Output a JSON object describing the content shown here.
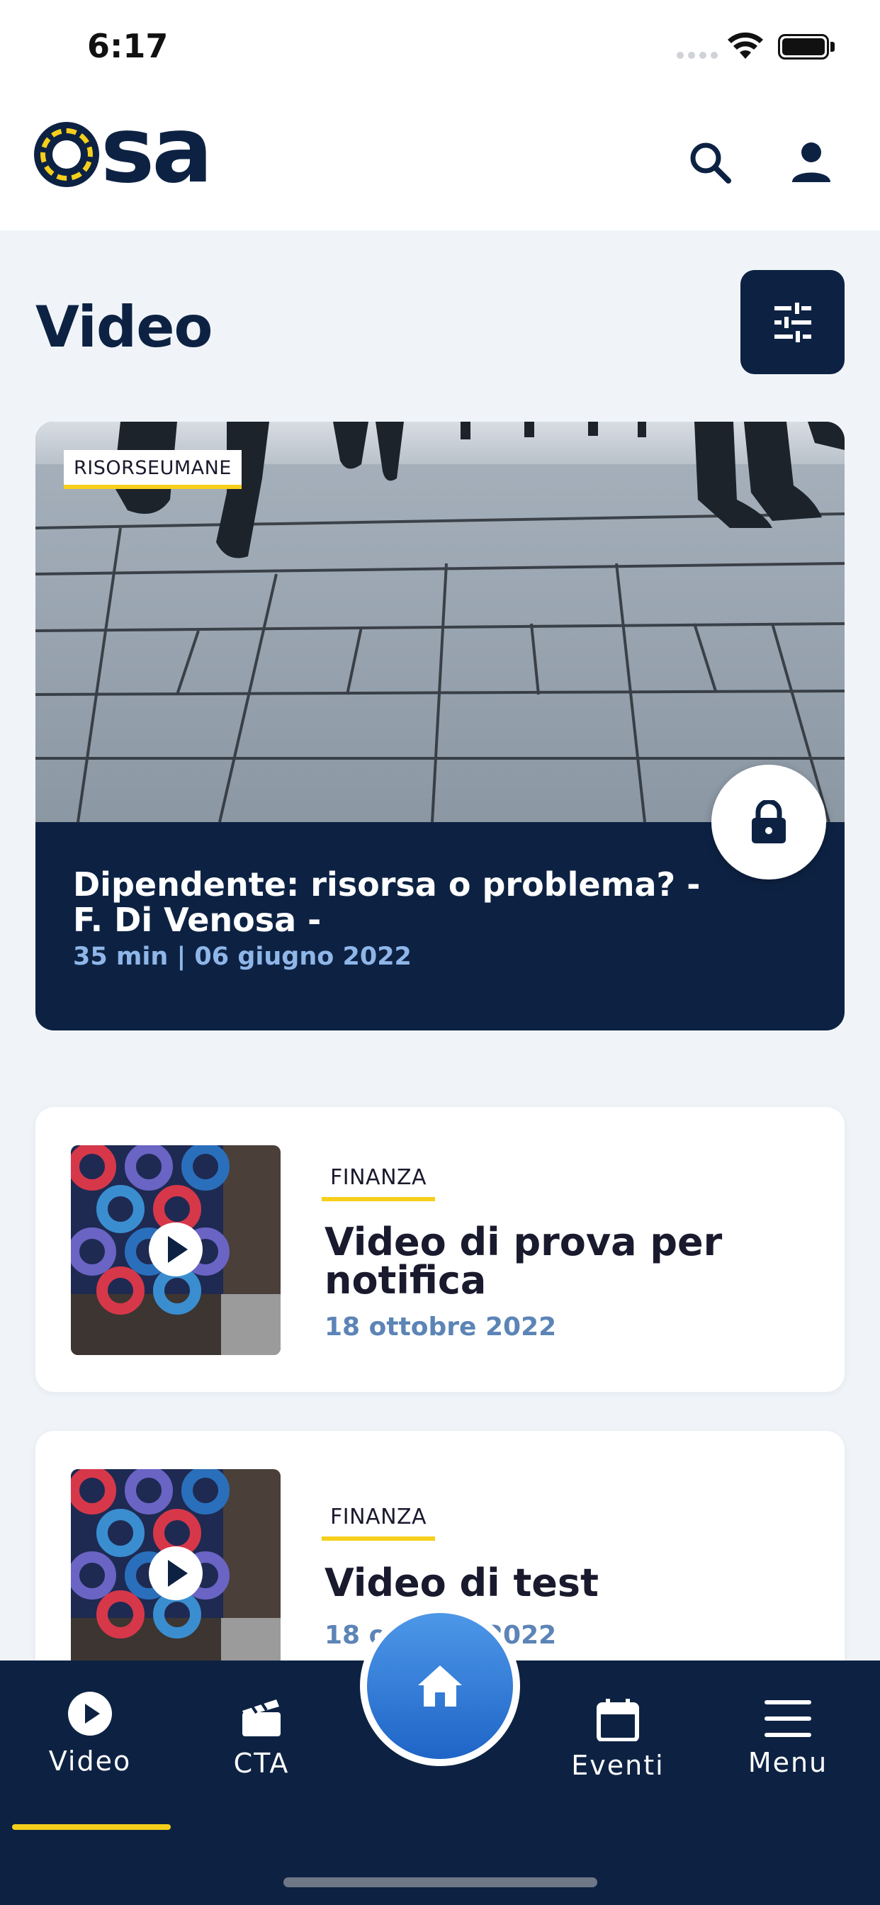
{
  "status_bar": {
    "time": "6:17"
  },
  "header": {
    "logo_text": "sa"
  },
  "page": {
    "title": "Video"
  },
  "featured": {
    "tag": "RISORSEUMANE",
    "title": "Dipendente: risorsa o problema? - F. Di Venosa -",
    "meta": "35 min  |  06 giugno 2022",
    "locked": true
  },
  "videos": [
    {
      "tag": "FINANZA",
      "title": "Video di prova per notifica",
      "date": "18 ottobre 2022"
    },
    {
      "tag": "FINANZA",
      "title": "Video di test",
      "date": "18 ottobre 2022"
    }
  ],
  "nav": {
    "items": [
      {
        "label": "Video",
        "icon": "play-circle-icon",
        "active": true
      },
      {
        "label": "CTA",
        "icon": "clapperboard-icon"
      },
      {
        "label": "",
        "icon": "home-icon"
      },
      {
        "label": "Eventi",
        "icon": "calendar-icon"
      },
      {
        "label": "Menu",
        "icon": "menu-icon"
      }
    ]
  },
  "colors": {
    "primary": "#0d2243",
    "accent": "#f5cf1b",
    "home_blue": "#2f7ad9",
    "date_blue": "#5c84b6"
  }
}
